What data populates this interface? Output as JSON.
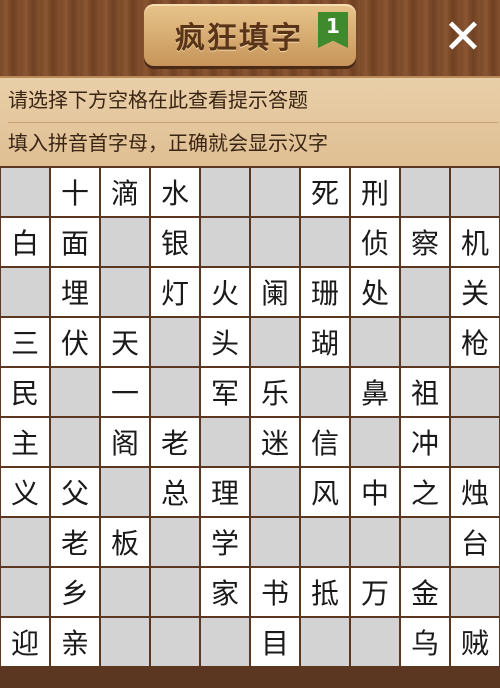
{
  "header": {
    "title": "疯狂填字",
    "level": "1",
    "close_label": "✕"
  },
  "hints": {
    "line1": "请选择下方空格在此查看提示答题",
    "line2": "填入拼音首字母，正确就会显示汉字"
  },
  "colors": {
    "wood": "#6b3f22",
    "hint_bg": "#e3c49b",
    "cell_white": "#ffffff",
    "cell_gray": "#d3d3d3",
    "badge_green": "#3e8a2c"
  },
  "grid": {
    "cols": 10,
    "rows": 10,
    "cells": [
      [
        null,
        "十",
        "滴",
        "水",
        null,
        null,
        "死",
        "刑",
        null,
        null
      ],
      [
        "白",
        "面",
        null,
        "银",
        null,
        null,
        null,
        "侦",
        "察",
        "机"
      ],
      [
        null,
        "埋",
        null,
        "灯",
        "火",
        "阑",
        "珊",
        "处",
        null,
        "关"
      ],
      [
        "三",
        "伏",
        "天",
        null,
        "头",
        null,
        "瑚",
        null,
        null,
        "枪"
      ],
      [
        "民",
        null,
        "一",
        null,
        "军",
        "乐",
        null,
        "鼻",
        "祖",
        null
      ],
      [
        "主",
        null,
        "阁",
        "老",
        null,
        "迷",
        "信",
        null,
        "冲",
        null
      ],
      [
        "义",
        "父",
        null,
        "总",
        "理",
        null,
        "风",
        "中",
        "之",
        "烛"
      ],
      [
        null,
        "老",
        "板",
        null,
        "学",
        null,
        null,
        null,
        null,
        "台"
      ],
      [
        null,
        "乡",
        null,
        null,
        "家",
        "书",
        "抵",
        "万",
        "金",
        null
      ],
      [
        "迎",
        "亲",
        null,
        null,
        null,
        "目",
        null,
        null,
        "乌",
        "贼"
      ]
    ]
  }
}
